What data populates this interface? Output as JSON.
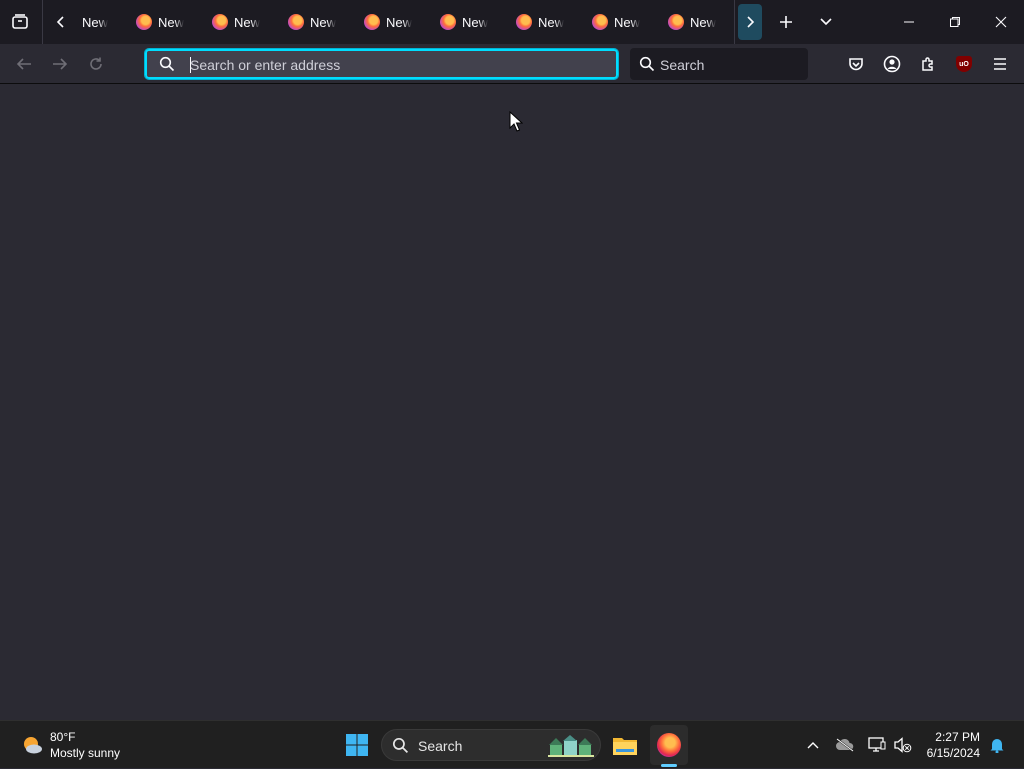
{
  "browser": {
    "tabs": [
      {
        "label": "New Tab"
      },
      {
        "label": "New Tab"
      },
      {
        "label": "New Tab"
      },
      {
        "label": "New Tab"
      },
      {
        "label": "New Tab"
      },
      {
        "label": "New Tab"
      },
      {
        "label": "New Tab"
      },
      {
        "label": "New Tab"
      },
      {
        "label": "New Tab"
      }
    ],
    "urlbar": {
      "placeholder": "Search or enter address",
      "value": ""
    },
    "searchbar": {
      "placeholder": "Search"
    },
    "extension_badge": "uO",
    "icons": [
      "tab-overview-icon",
      "scroll-tabs-left-icon",
      "scroll-tabs-right-icon",
      "new-tab-icon",
      "list-all-tabs-icon",
      "minimize-icon",
      "restore-icon",
      "close-icon",
      "back-icon",
      "forward-icon",
      "reload-icon",
      "search-icon",
      "pocket-icon",
      "account-icon",
      "extensions-icon",
      "ublock-origin-icon",
      "hamburger-menu-icon"
    ],
    "accent_color": "#00ddff"
  },
  "taskbar": {
    "weather": {
      "temp": "80°F",
      "condition": "Mostly sunny"
    },
    "search_label": "Search",
    "clock": {
      "time": "2:27 PM",
      "date": "6/15/2024"
    },
    "icons": [
      "weather-sun-icon",
      "windows-start-icon",
      "search-icon",
      "search-highlight-icon",
      "file-explorer-icon",
      "firefox-icon",
      "show-hidden-icons-chevron-icon",
      "onedrive-offline-icon",
      "network-icon",
      "volume-muted-icon",
      "notification-bell-icon"
    ]
  }
}
